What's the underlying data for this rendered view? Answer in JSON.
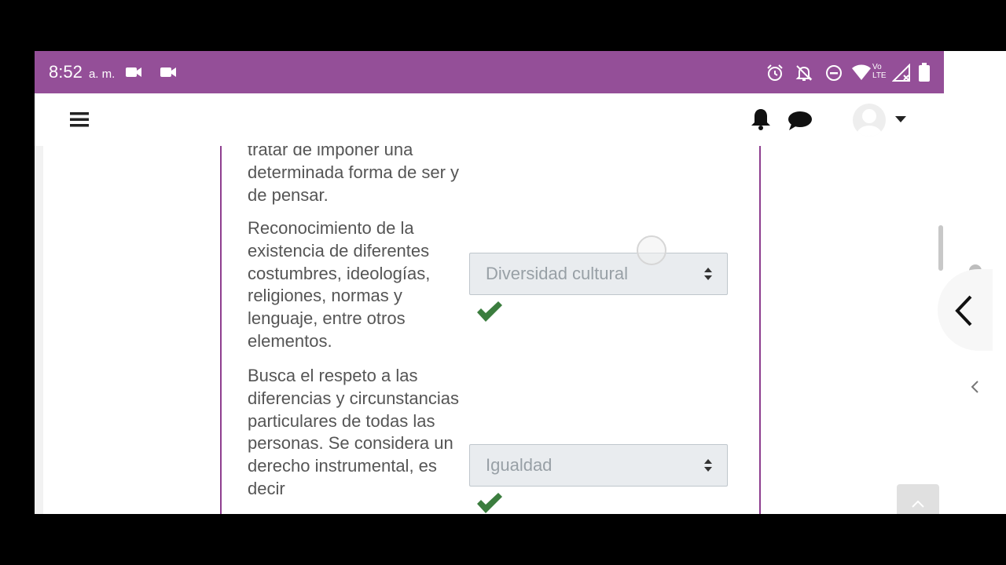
{
  "status_bar": {
    "time": "8:52",
    "period": "a. m.",
    "network_label": "Vo LTE"
  },
  "app_bar": {
    "icons": [
      "menu-icon",
      "bell-icon",
      "chat-icon",
      "avatar",
      "caret-down-icon"
    ]
  },
  "question": {
    "rows": [
      {
        "text": "tratar de imponer una determinada forma de ser y de pensar."
      },
      {
        "text": "Reconocimiento de la existencia de diferentes costumbres, ideologías, religiones, normas y lenguaje, entre otros elementos.",
        "selected": "Diversidad cultural",
        "correct": true
      },
      {
        "text": "Busca el respeto a las diferencias y circunstancias particulares de todas las personas. Se considera un derecho instrumental, es decir",
        "selected": "Igualdad",
        "correct": true
      }
    ]
  },
  "colors": {
    "status_bar": "#944f98",
    "frame": "#8e3e8f",
    "check": "#3b7d3e"
  }
}
